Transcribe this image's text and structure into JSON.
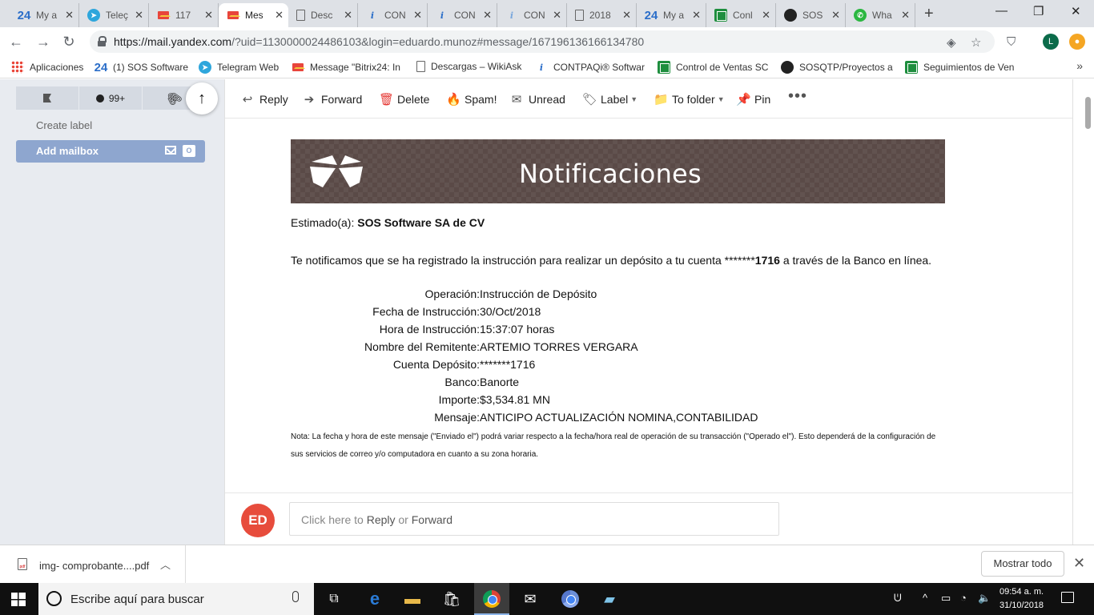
{
  "browser": {
    "tabs": [
      {
        "label": "My a",
        "icon": "bitrix24-icon"
      },
      {
        "label": "Teleç",
        "icon": "telegram-icon"
      },
      {
        "label": "117",
        "icon": "yandex-mail-icon"
      },
      {
        "label": "Mes",
        "icon": "yandex-mail-icon",
        "active": true
      },
      {
        "label": "Desc",
        "icon": "document-icon"
      },
      {
        "label": "CON",
        "icon": "contpaqi-icon"
      },
      {
        "label": "CON",
        "icon": "contpaqi-icon"
      },
      {
        "label": "CON",
        "icon": "contpaqi-icon"
      },
      {
        "label": "2018",
        "icon": "document-icon"
      },
      {
        "label": "My a",
        "icon": "bitrix24-icon"
      },
      {
        "label": "Conl",
        "icon": "sheets-icon"
      },
      {
        "label": "SOS",
        "icon": "github-icon"
      },
      {
        "label": "Wha",
        "icon": "whatsapp-icon"
      }
    ],
    "url_host": "https://mail.yandex.com",
    "url_path": "/?uid=1130000024486103&login=eduardo.munoz#message/167196136166134780",
    "profile_initial": "L",
    "bookmarks": [
      {
        "label": "Aplicaciones",
        "icon": "apps-icon"
      },
      {
        "label": "(1) SOS Software",
        "icon": "bitrix24-icon"
      },
      {
        "label": "Telegram Web",
        "icon": "telegram-icon"
      },
      {
        "label": "Message \"Bitrix24: In",
        "icon": "yandex-mail-icon"
      },
      {
        "label": "Descargas – WikiAsk",
        "icon": "document-icon"
      },
      {
        "label": "CONTPAQi® Softwar",
        "icon": "contpaqi-icon"
      },
      {
        "label": "Control de Ventas SC",
        "icon": "sheets-icon"
      },
      {
        "label": "SOSQTP/Proyectos at",
        "icon": "github-icon"
      },
      {
        "label": "Seguimientos de Ven",
        "icon": "sheets-icon"
      }
    ]
  },
  "sidebar": {
    "unread_count": "99+",
    "create_label": "Create label",
    "add_mailbox": "Add mailbox"
  },
  "toolbar": {
    "reply": "Reply",
    "forward": "Forward",
    "delete": "Delete",
    "spam": "Spam!",
    "unread": "Unread",
    "label": "Label",
    "to_folder": "To folder",
    "pin": "Pin"
  },
  "message": {
    "banner_title": "Notificaciones",
    "greeting_prefix": "Estimado(a):",
    "greeting_name": "SOS Software SA de CV",
    "notice_pre": "Te notificamos que se ha registrado la instrucción para realizar un depósito a tu cuenta *******",
    "notice_account": "1716",
    "notice_post": " a través de la Banco en línea.",
    "details": [
      {
        "label": "Operación:",
        "value": "Instrucción de Depósito"
      },
      {
        "label": "Fecha de Instrucción:",
        "value": "30/Oct/2018"
      },
      {
        "label": "Hora de Instrucción:",
        "value": "15:37:07 horas"
      },
      {
        "label": "Nombre del Remitente:",
        "value": "ARTEMIO TORRES VERGARA"
      },
      {
        "label": "Cuenta Depósito:",
        "value": "*******1716"
      },
      {
        "label": "Banco:",
        "value": "Banorte"
      },
      {
        "label": "Importe:",
        "value": "$3,534.81 MN"
      },
      {
        "label": "Mensaje:",
        "value": "ANTICIPO ACTUALIZACIÓN NOMINA,CONTABILIDAD"
      }
    ],
    "note": "Nota: La fecha y hora de este mensaje (\"Enviado el\") podrá variar respecto a la fecha/hora real de operación de su transacción (\"Operado el\"). Esto dependerá de la configuración de sus servicios de correo y/o computadora en cuanto a su zona horaria."
  },
  "reply_bar": {
    "avatar_initials": "ED",
    "prefix": "Click here to",
    "reply_link": "Reply",
    "or": "or",
    "forward_link": "Forward"
  },
  "downloads": {
    "file_name": "img- comprobante....pdf",
    "show_all": "Mostrar todo"
  },
  "taskbar": {
    "search_placeholder": "Escribe aquí para buscar",
    "time": "09:54 a. m.",
    "date": "31/10/2018"
  }
}
